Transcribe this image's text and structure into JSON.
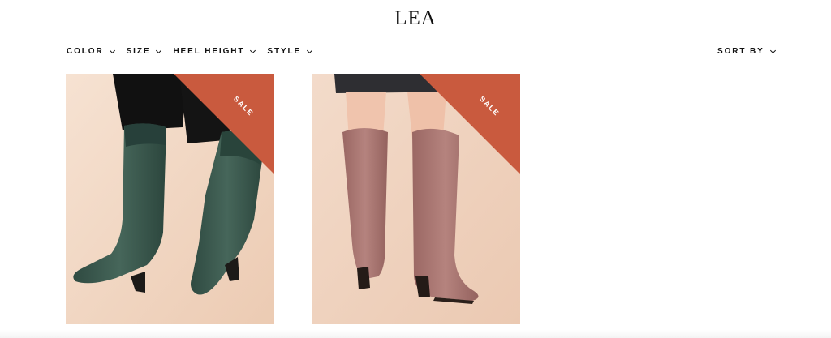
{
  "header": {
    "brand": "LEA"
  },
  "filters": [
    {
      "label": "COLOR"
    },
    {
      "label": "SIZE"
    },
    {
      "label": "HEEL HEIGHT"
    },
    {
      "label": "STYLE"
    }
  ],
  "sort": {
    "label": "SORT BY"
  },
  "products": [
    {
      "badge": "SALE",
      "image_subject": "green leather knee-high boots",
      "boot_color": "#3c5a50"
    },
    {
      "badge": "SALE",
      "image_subject": "dusty rose suede knee-high boots",
      "boot_color": "#a87672"
    }
  ],
  "colors": {
    "sale_ribbon": "#c95a3e",
    "photo_background": "#f1d9c6"
  }
}
